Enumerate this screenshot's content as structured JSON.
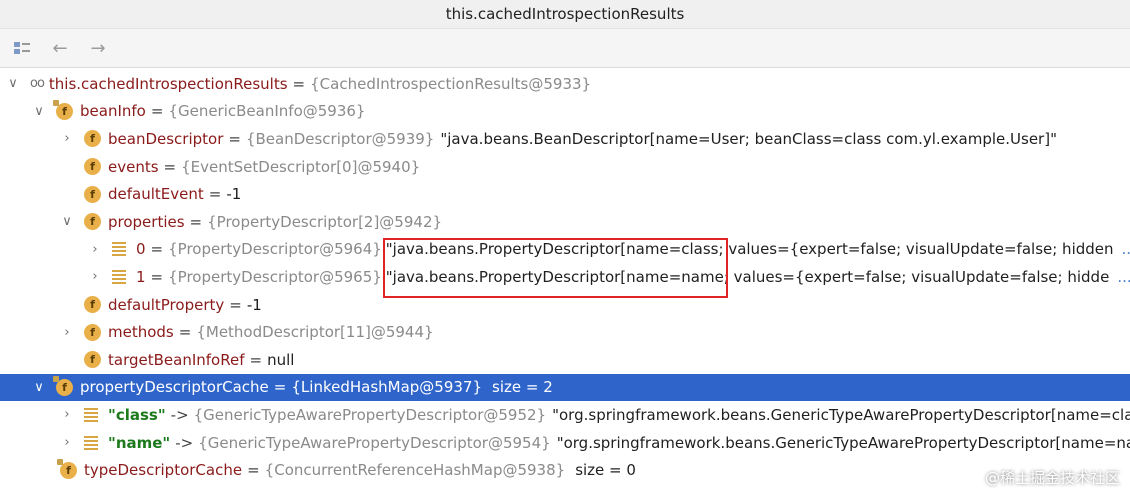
{
  "window": {
    "title": "this.cachedIntrospectionResults"
  },
  "toolbar": {
    "tree_icon": "tree-view-icon",
    "back_icon": "arrow-left-icon",
    "forward_icon": "arrow-right-icon"
  },
  "tree": {
    "root": {
      "name": "this.cachedIntrospectionResults",
      "meta": "{CachedIntrospectionResults@5933}"
    },
    "beanInfo": {
      "name": "beanInfo",
      "meta": "{GenericBeanInfo@5936}"
    },
    "beanDescriptor": {
      "name": "beanDescriptor",
      "meta": "{BeanDescriptor@5939}",
      "value": "\"java.beans.BeanDescriptor[name=User; beanClass=class com.yl.example.User]\""
    },
    "events": {
      "name": "events",
      "meta": "{EventSetDescriptor[0]@5940}"
    },
    "defaultEvent": {
      "name": "defaultEvent",
      "value": "-1"
    },
    "properties": {
      "name": "properties",
      "meta": "{PropertyDescriptor[2]@5942}"
    },
    "prop0": {
      "name": "0",
      "meta": "{PropertyDescriptor@5964}",
      "value": "\"java.beans.PropertyDescriptor[name=class; values={expert=false; visualUpdate=false; hidden",
      "view": "... View"
    },
    "prop1": {
      "name": "1",
      "meta": "{PropertyDescriptor@5965}",
      "value": "\"java.beans.PropertyDescriptor[name=name; values={expert=false; visualUpdate=false; hidde",
      "view": "... View"
    },
    "defaultProperty": {
      "name": "defaultProperty",
      "value": "-1"
    },
    "methods": {
      "name": "methods",
      "meta": "{MethodDescriptor[11]@5944}"
    },
    "targetBeanInfoRef": {
      "name": "targetBeanInfoRef",
      "value": "null"
    },
    "propertyDescriptorCache": {
      "name": "propertyDescriptorCache",
      "meta": "{LinkedHashMap@5937}",
      "size": "size = 2"
    },
    "entryClass": {
      "name": "\"class\"",
      "arrow": "->",
      "meta": "{GenericTypeAwarePropertyDescriptor@5952}",
      "value": "\"org.springframework.beans.GenericTypeAwarePropertyDescriptor[name=cla"
    },
    "entryName": {
      "name": "\"name\"",
      "arrow": "->",
      "meta": "{GenericTypeAwarePropertyDescriptor@5954}",
      "value": "\"org.springframework.beans.GenericTypeAwarePropertyDescriptor[name=na"
    },
    "typeDescriptorCache": {
      "name": "typeDescriptorCache",
      "meta": "{ConcurrentReferenceHashMap@5938}",
      "size": "size = 0"
    }
  },
  "watermark": "@稀土掘金技术社区",
  "colors": {
    "selection": "#2f65ca",
    "field_name": "#8b1a1a",
    "highlight_box": "#e02424"
  }
}
